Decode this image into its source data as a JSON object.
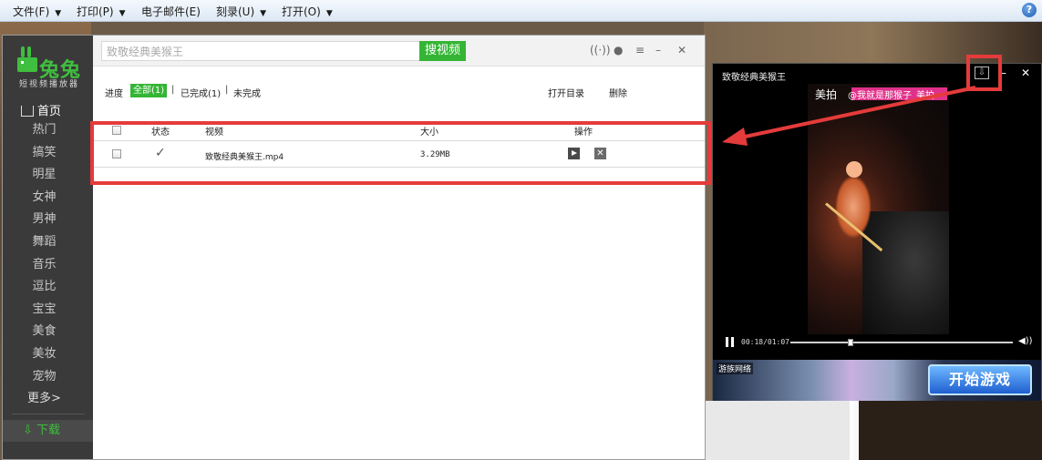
{
  "menubar": {
    "items": [
      {
        "label": "文件(F)"
      },
      {
        "label": "打印(P)"
      },
      {
        "label": "电子邮件(E)"
      },
      {
        "label": "刻录(U)"
      },
      {
        "label": "打开(O)"
      }
    ],
    "help": "?"
  },
  "app": {
    "logo_text": "兔兔",
    "logo_sub": "短视频播放器",
    "nav_home": "首页",
    "nav_items": [
      "热门",
      "搞笑",
      "明星",
      "女神",
      "男神",
      "舞蹈",
      "音乐",
      "逗比",
      "宝宝",
      "美食",
      "美妆",
      "宠物",
      "更多>"
    ],
    "nav_download": "下载",
    "search": {
      "value": "致敬经典美猴王",
      "button": "搜视频"
    },
    "filters": {
      "label": "进度",
      "all": "全部(1)",
      "done": "已完成(1)",
      "undone": "未完成",
      "open_dir": "打开目录",
      "delete": "删除"
    },
    "table": {
      "headers": {
        "status": "状态",
        "video": "视频",
        "size": "大小",
        "action": "操作"
      },
      "rows": [
        {
          "status": "✓",
          "name": "致敬经典美猴王.mp4",
          "size": "3.29MB"
        }
      ]
    }
  },
  "player": {
    "title": "致敬经典美猴王",
    "watermark_brand": "美拍",
    "watermark_handle": "@我就是那猴子_美拍",
    "time": "00:18/01:07",
    "progress_fraction": 0.27,
    "ad_brand": "游族网络",
    "ad_button": "开始游戏"
  },
  "colors": {
    "accent": "#35b535",
    "highlight": "#e53b3b",
    "sidebar": "#3a3a3a"
  }
}
